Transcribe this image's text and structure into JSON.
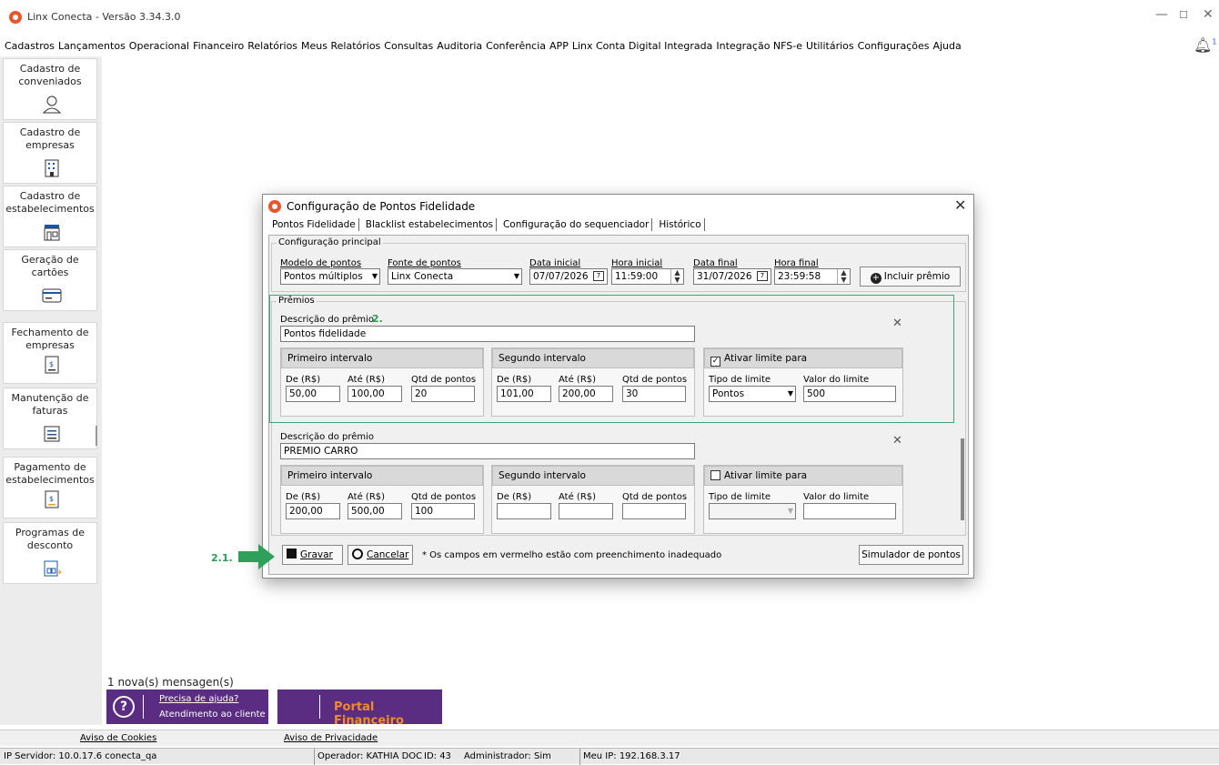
{
  "app": {
    "title": "Linx Conecta - Versão 3.34.3.0",
    "notification_count": "1"
  },
  "menu": [
    "Cadastros",
    "Lançamentos",
    "Operacional",
    "Financeiro",
    "Relatórios",
    "Meus Relatórios",
    "Consultas",
    "Auditoria",
    "Conferência",
    "APP",
    "Linx Conta Digital Integrada",
    "Integração NFS-e",
    "Utilitários",
    "Configurações",
    "Ajuda"
  ],
  "sidebar": [
    {
      "label": "Cadastro de conveniados",
      "icon": "person-icon"
    },
    {
      "label": "Cadastro de empresas",
      "icon": "building-icon"
    },
    {
      "label": "Cadastro de estabelecimentos",
      "icon": "store-icon"
    },
    {
      "label": "Geração de cartões",
      "icon": "card-icon"
    },
    {
      "label": "Fechamento de empresas",
      "icon": "invoice-close-icon"
    },
    {
      "label": "Manutenção de faturas",
      "icon": "tray-icon"
    },
    {
      "label": "Pagamento de estabelecimentos",
      "icon": "payment-icon"
    },
    {
      "label": "Programas de desconto",
      "icon": "discount-program-icon"
    }
  ],
  "messages": "1 nova(s) mensagen(s)",
  "help": {
    "line1": "Precisa de ajuda?",
    "line2": "Atendimento ao cliente"
  },
  "portal": "Portal Financeiro",
  "links": {
    "cookies": "Aviso de Cookies",
    "privacy": "Aviso de Privacidade"
  },
  "status": {
    "server": "IP Servidor: 10.0.17.6 conecta_qa",
    "operator": "Operador: KATHIA DOC",
    "id": "ID: 43",
    "admin": "Administrador: Sim",
    "ip": "Meu IP: 192.168.3.17"
  },
  "dialog": {
    "title": "Configuração de Pontos Fidelidade",
    "tabs": [
      "Pontos Fidelidade",
      "Blacklist estabelecimentos",
      "Configuração do sequenciador",
      "Histórico"
    ],
    "main_group": "Configuração principal",
    "fields": {
      "modelo_label": "Modelo de pontos",
      "modelo_value": "Pontos múltiplos",
      "fonte_label": "Fonte de pontos",
      "fonte_value": "Linx Conecta",
      "data_inicial_label": "Data inicial",
      "data_inicial_value": "07/07/2026",
      "hora_inicial_label": "Hora inicial",
      "hora_inicial_value": "11:59:00",
      "data_final_label": "Data final",
      "data_final_value": "31/07/2026",
      "hora_final_label": "Hora final",
      "hora_final_value": "23:59:58"
    },
    "include_button": "Incluir prêmio",
    "prizes_group": "Prêmios",
    "desc_label": "Descrição do prêmio",
    "interval1": "Primeiro intervalo",
    "interval2": "Segundo intervalo",
    "limit_label": "Ativar limite para",
    "col_de": "De (R$)",
    "col_ate": "Até (R$)",
    "col_qtd": "Qtd de pontos",
    "col_tipo": "Tipo de limite",
    "col_valor": "Valor do limite",
    "prizes": [
      {
        "desc": "Pontos fidelidade",
        "i1": {
          "de": "50,00",
          "ate": "100,00",
          "qtd": "20"
        },
        "i2": {
          "de": "101,00",
          "ate": "200,00",
          "qtd": "30"
        },
        "limit_checked": true,
        "tipo": "Pontos",
        "valor": "500"
      },
      {
        "desc": "PREMIO CARRO",
        "i1": {
          "de": "200,00",
          "ate": "500,00",
          "qtd": "100"
        },
        "i2": {
          "de": "",
          "ate": "",
          "qtd": ""
        },
        "limit_checked": false,
        "tipo": "",
        "valor": ""
      }
    ],
    "save": "Gravar",
    "cancel": "Cancelar",
    "note": "* Os campos em vermelho estão com preenchimento inadequado",
    "simulator": "Simulador de pontos"
  },
  "annotations": {
    "a1": "2.",
    "a2": "2.1."
  }
}
